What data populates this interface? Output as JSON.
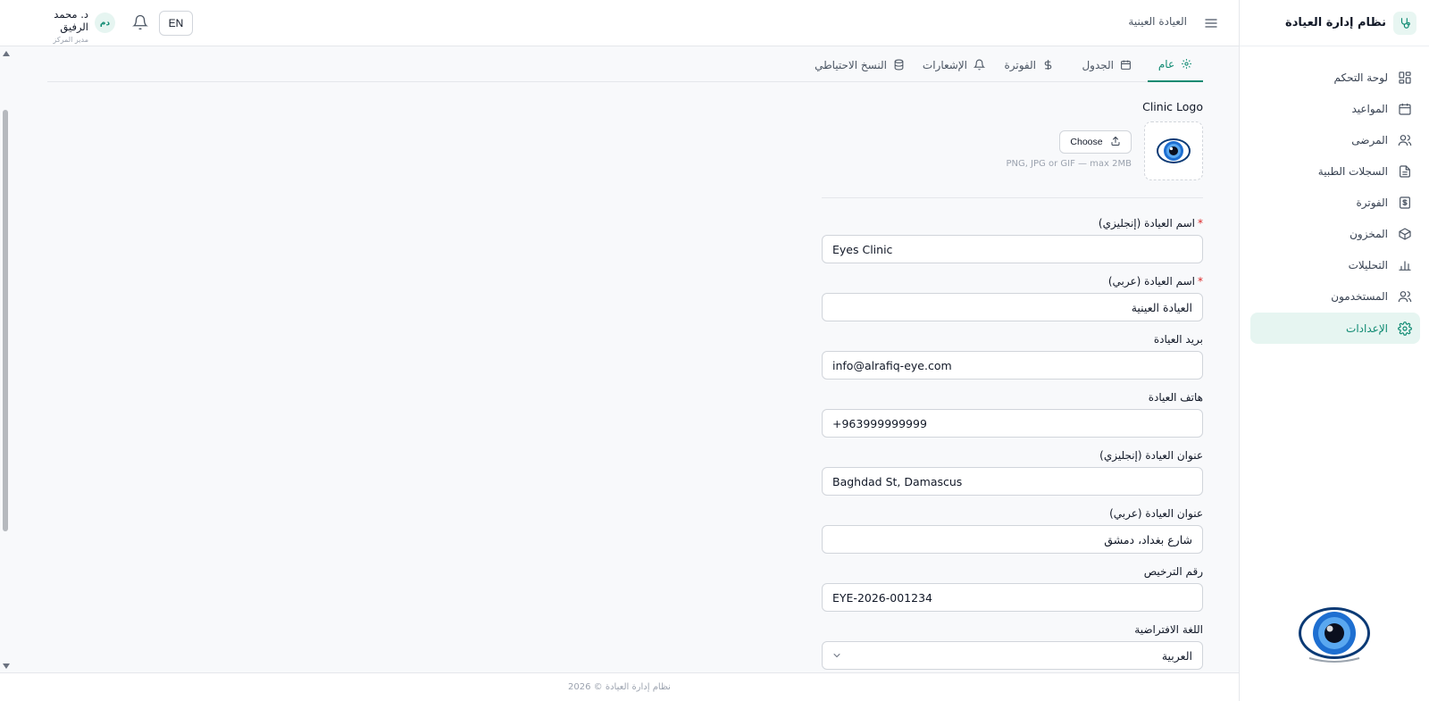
{
  "brand": {
    "title": "نظام إدارة العيادة"
  },
  "sidebar": {
    "items": [
      {
        "label": "لوحة التحكم",
        "icon": "dashboard-icon"
      },
      {
        "label": "المواعيد",
        "icon": "calendar-icon"
      },
      {
        "label": "المرضى",
        "icon": "users-icon"
      },
      {
        "label": "السجلات الطبية",
        "icon": "file-icon"
      },
      {
        "label": "الفوترة",
        "icon": "dollar-icon"
      },
      {
        "label": "المخزون",
        "icon": "package-icon"
      },
      {
        "label": "التحليلات",
        "icon": "bar-chart-icon"
      },
      {
        "label": "المستخدمون",
        "icon": "users-icon"
      },
      {
        "label": "الإعدادات",
        "icon": "gear-icon",
        "active": true
      }
    ]
  },
  "topbar": {
    "clinic_name": "العيادة العينية",
    "user_name": "د. محمد الرفيق",
    "user_role": "مدير المركز",
    "avatar_initials": "دم",
    "lang_button": "EN"
  },
  "tabs": [
    {
      "label": "عام",
      "icon": "gear-icon",
      "active": true
    },
    {
      "label": "الجدول",
      "icon": "calendar-icon"
    },
    {
      "label": "الفوترة",
      "icon": "dollar-icon"
    },
    {
      "label": "الإشعارات",
      "icon": "bell-icon"
    },
    {
      "label": "النسخ الاحتياطي",
      "icon": "database-icon"
    }
  ],
  "logo_section": {
    "label": "Clinic Logo",
    "choose_label": "Choose",
    "hint": "PNG, JPG or GIF — max 2MB"
  },
  "fields": {
    "name_en": {
      "label": "اسم العيادة (إنجليزي)",
      "required_mark": "*",
      "value": "Eyes Clinic"
    },
    "name_ar": {
      "label": "اسم العيادة (عربي)",
      "required_mark": "*",
      "value": "العيادة العينية"
    },
    "email": {
      "label": "بريد العيادة",
      "value": "info@alrafiq-eye.com"
    },
    "phone": {
      "label": "هاتف العيادة",
      "value": "+963999999999"
    },
    "address_en": {
      "label": "عنوان العيادة (إنجليزي)",
      "value": "Baghdad St, Damascus"
    },
    "address_ar": {
      "label": "عنوان العيادة (عربي)",
      "value": "شارع بغداد، دمشق"
    },
    "license": {
      "label": "رقم الترخيص",
      "value": "EYE-2026-001234"
    },
    "language": {
      "label": "اللغة الافتراضية",
      "value": "العربية"
    }
  },
  "footer": {
    "text": "نظام إدارة العيادة © 2026"
  },
  "colors": {
    "accent": "#0f8a72",
    "accent_bg": "#e6f5f1",
    "required": "#dc2626"
  }
}
